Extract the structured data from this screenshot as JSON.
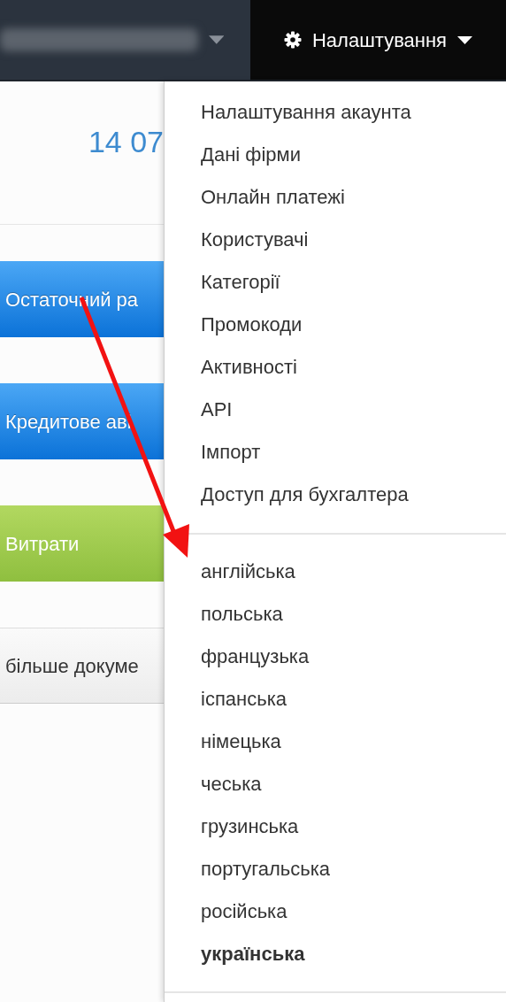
{
  "navbar": {
    "settings_menu": {
      "label": "Налаштування",
      "expanded": true
    }
  },
  "summary": {
    "amount": "14 07"
  },
  "actions": [
    {
      "label": "Остаточний ра",
      "kind": "primary"
    },
    {
      "label": "Кредитове аві",
      "kind": "primary"
    },
    {
      "label": "Витрати",
      "kind": "success"
    },
    {
      "label": "більше докуме",
      "kind": "light"
    }
  ],
  "menu": {
    "items": [
      "Налаштування акаунта",
      "Дані фірми",
      "Онлайн платежі",
      "Користувачі",
      "Категорії",
      "Промокоди",
      "Активності",
      "API",
      "Імпорт",
      "Доступ для бухгалтера"
    ],
    "languages": [
      {
        "label": "англійська",
        "selected": false
      },
      {
        "label": "польська",
        "selected": false
      },
      {
        "label": "французька",
        "selected": false
      },
      {
        "label": "іспанська",
        "selected": false
      },
      {
        "label": "німецька",
        "selected": false
      },
      {
        "label": "чеська",
        "selected": false
      },
      {
        "label": "грузинська",
        "selected": false
      },
      {
        "label": "португальська",
        "selected": false
      },
      {
        "label": "російська",
        "selected": false
      },
      {
        "label": "українська",
        "selected": true
      }
    ]
  }
}
